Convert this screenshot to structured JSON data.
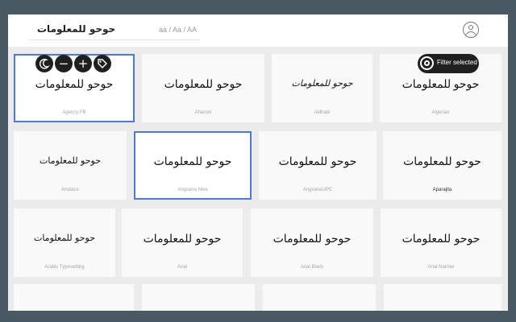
{
  "search": {
    "value": "حوحو للمعلومات",
    "case_options": "aa / Aa / AA"
  },
  "toolbar": {
    "theme_icon": "moon-icon",
    "decrease_icon": "minus-icon",
    "increase_icon": "plus-icon",
    "tag_icon": "tag-icon",
    "minus_glyph": "−",
    "plus_glyph": "+"
  },
  "filter": {
    "label": "Filter selected"
  },
  "sample_text": "حوحو للمعلومات",
  "fonts": [
    {
      "name": "Agency FB"
    },
    {
      "name": "Aharoni"
    },
    {
      "name": "Aldhabi"
    },
    {
      "name": "Algerian"
    },
    {
      "name": "Andalus"
    },
    {
      "name": "Angsana New"
    },
    {
      "name": "AngsanaUPC"
    },
    {
      "name": "Aparajita"
    },
    {
      "name": "Arabic Typesetting"
    },
    {
      "name": "Arial"
    },
    {
      "name": "Arial Black"
    },
    {
      "name": "Arial Narrow"
    }
  ],
  "colors": {
    "frame": "#4a5a63",
    "selected_border": "#4f76e6",
    "pill": "#1f1f1f"
  }
}
